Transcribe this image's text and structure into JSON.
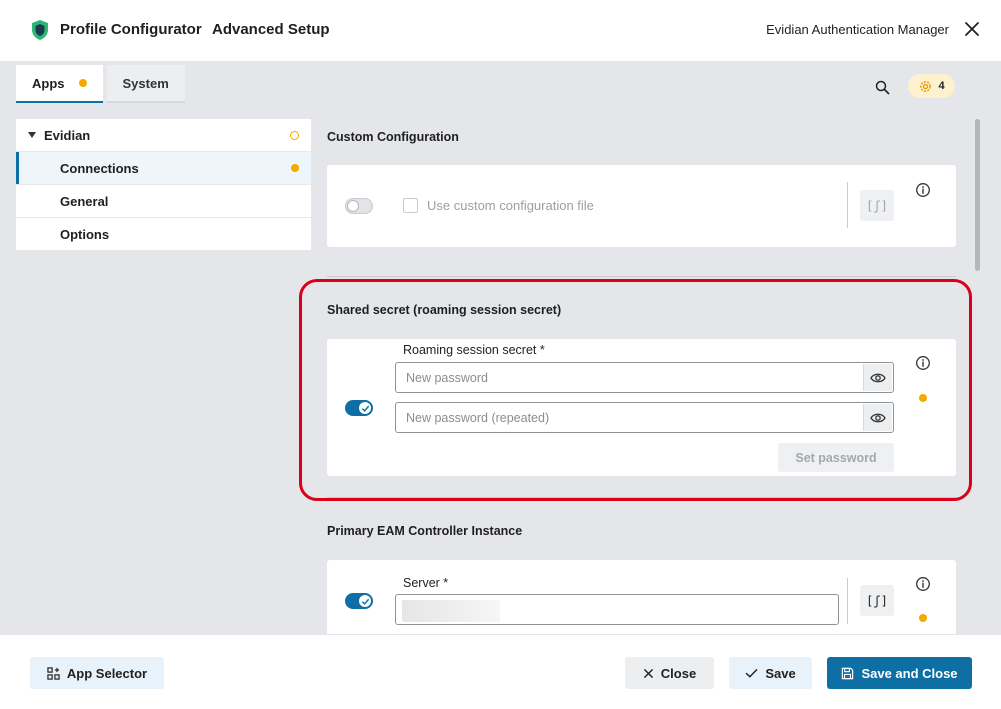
{
  "header": {
    "title": "Profile Configurator",
    "subtitle": "Advanced Setup",
    "product_name": "Evidian Authentication Manager"
  },
  "tabs": [
    {
      "label": "Apps",
      "active": true,
      "has_status_dot": true
    },
    {
      "label": "System",
      "active": false
    }
  ],
  "notifications": {
    "count": "4"
  },
  "nav": {
    "group_label": "Evidian",
    "items": [
      {
        "label": "Connections",
        "selected": true,
        "has_status_dot": true
      },
      {
        "label": "General"
      },
      {
        "label": "Options"
      }
    ]
  },
  "sections": {
    "custom_config": {
      "title": "Custom Configuration",
      "checkbox_label": "Use custom configuration file",
      "script_button": "[ʃ]"
    },
    "shared_secret": {
      "title": "Shared secret (roaming session secret)",
      "field_label": "Roaming session secret *",
      "password_placeholder": "New password",
      "password_repeat_placeholder": "New password (repeated)",
      "set_password_button": "Set password"
    },
    "primary_eam": {
      "title": "Primary EAM Controller Instance",
      "field_label": "Server *",
      "script_button": "[ʃ]"
    }
  },
  "footer": {
    "app_selector": "App Selector",
    "close": "Close",
    "save": "Save",
    "save_and_close": "Save and Close"
  },
  "colors": {
    "accent": "#0e6fa5",
    "warning": "#f2a900",
    "highlight": "#d9001b"
  }
}
